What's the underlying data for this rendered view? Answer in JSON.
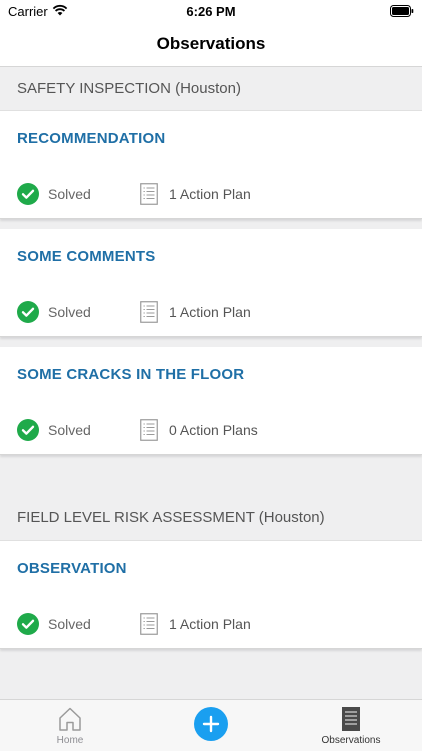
{
  "status_bar": {
    "carrier": "Carrier",
    "time": "6:26 PM"
  },
  "nav": {
    "title": "Observations"
  },
  "sections": [
    {
      "header": "SAFETY INSPECTION (Houston)",
      "items": [
        {
          "title": "RECOMMENDATION",
          "status": "Solved",
          "plans": "1 Action Plan"
        },
        {
          "title": "SOME COMMENTS",
          "status": "Solved",
          "plans": "1 Action Plan"
        },
        {
          "title": "SOME CRACKS IN THE FLOOR",
          "status": "Solved",
          "plans": "0 Action Plans"
        }
      ]
    },
    {
      "header": "FIELD LEVEL RISK ASSESSMENT (Houston)",
      "items": [
        {
          "title": "OBSERVATION",
          "status": "Solved",
          "plans": "1 Action Plan"
        }
      ]
    }
  ],
  "tabs": {
    "home": "Home",
    "observations": "Observations"
  },
  "colors": {
    "accent": "#1f6fa6",
    "solved": "#1faa4a",
    "add_button": "#1a9ff0"
  }
}
